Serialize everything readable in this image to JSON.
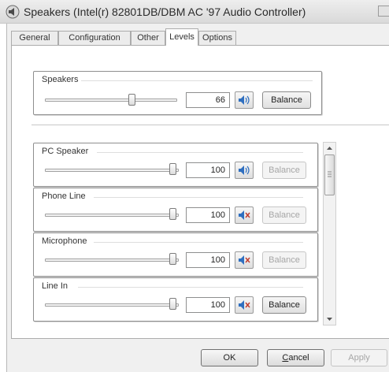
{
  "window": {
    "title": "Speakers (Intel(r) 82801DB/DBM AC '97 Audio Controller)"
  },
  "tabs": [
    {
      "label": "General",
      "active": false
    },
    {
      "label": "Configuration",
      "active": false
    },
    {
      "label": "Other",
      "active": false
    },
    {
      "label": "Levels",
      "active": true
    },
    {
      "label": "Options",
      "active": false
    }
  ],
  "master": {
    "label": "Speakers",
    "value": "66",
    "level": 0.66,
    "balance_label": "Balance",
    "muted": false
  },
  "channels": [
    {
      "label": "PC Speaker",
      "value": "100",
      "level": 1.0,
      "balance_label": "Balance",
      "balance_enabled": false,
      "muted": false
    },
    {
      "label": "Phone Line",
      "value": "100",
      "level": 1.0,
      "balance_label": "Balance",
      "balance_enabled": false,
      "muted": true
    },
    {
      "label": "Microphone",
      "value": "100",
      "level": 1.0,
      "balance_label": "Balance",
      "balance_enabled": false,
      "muted": true
    },
    {
      "label": "Line In",
      "value": "100",
      "level": 1.0,
      "balance_label": "Balance",
      "balance_enabled": true,
      "muted": true
    }
  ],
  "footer": {
    "ok_label": "OK",
    "cancel_label": "Cancel",
    "apply_label": "Apply"
  },
  "icons": {
    "window": "speaker-icon",
    "volume": "speaker-volume-icon",
    "muted": "speaker-muted-icon"
  },
  "colors": {
    "accent_blue": "#2f6fc0",
    "mute_red": "#c0392b"
  }
}
